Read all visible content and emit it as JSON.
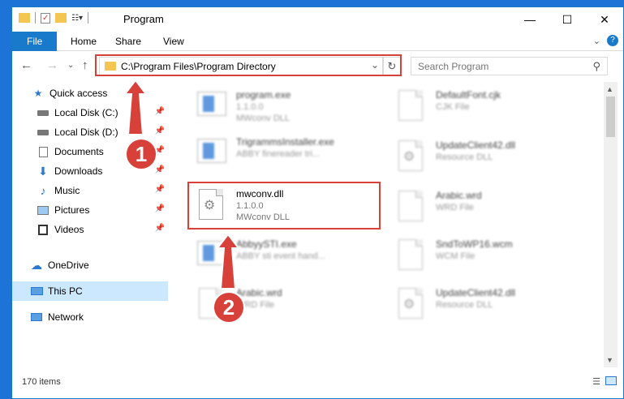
{
  "window": {
    "title": "Program",
    "controls": [
      "minimize",
      "maximize",
      "close"
    ]
  },
  "ribbon": {
    "tabs": [
      "File",
      "Home",
      "Share",
      "View"
    ]
  },
  "nav": {
    "address": "C:\\Program Files\\Program Directory",
    "search_placeholder": "Search Program"
  },
  "sidebar": {
    "items": [
      {
        "label": "Quick access",
        "icon": "star-icon"
      },
      {
        "label": "Local Disk (C:)",
        "icon": "drive-icon",
        "pinned": true
      },
      {
        "label": "Local Disk (D:)",
        "icon": "drive-icon",
        "pinned": true
      },
      {
        "label": "Documents",
        "icon": "documents-icon",
        "pinned": true
      },
      {
        "label": "Downloads",
        "icon": "download-icon",
        "pinned": true
      },
      {
        "label": "Music",
        "icon": "music-icon",
        "pinned": true
      },
      {
        "label": "Pictures",
        "icon": "pictures-icon",
        "pinned": true
      },
      {
        "label": "Videos",
        "icon": "videos-icon",
        "pinned": true
      },
      {
        "label": "OneDrive",
        "icon": "cloud-icon"
      },
      {
        "label": "This PC",
        "icon": "computer-icon",
        "selected": true
      },
      {
        "label": "Network",
        "icon": "network-icon"
      }
    ]
  },
  "files": {
    "left": [
      {
        "name": "program.exe",
        "line1": "1.1.0.0",
        "line2": "MWconv DLL",
        "type": "exe"
      },
      {
        "name": "TrigrammsInstaller.exe",
        "line1": "ABBY finereader tri...",
        "line2": "",
        "type": "exe"
      },
      {
        "name": "mwconv.dll",
        "line1": "1.1.0.0",
        "line2": "MWconv DLL",
        "type": "dll",
        "highlighted": true
      },
      {
        "name": "AbbyySTI.exe",
        "line1": "ABBY sti event hand...",
        "line2": "",
        "type": "exe"
      },
      {
        "name": "Arabic.wrd",
        "line1": "WRD File",
        "line2": "",
        "type": "doc"
      }
    ],
    "right": [
      {
        "name": "DefaultFont.cjk",
        "line1": "CJK File",
        "line2": "",
        "type": "doc"
      },
      {
        "name": "UpdateClient42.dll",
        "line1": "Resource DLL",
        "line2": "",
        "type": "dll"
      },
      {
        "name": "Arabic.wrd",
        "line1": "WRD File",
        "line2": "",
        "type": "doc"
      },
      {
        "name": "SndToWP16.wcm",
        "line1": "WCM File",
        "line2": "",
        "type": "doc"
      },
      {
        "name": "UpdateClient42.dll",
        "line1": "Resource DLL",
        "line2": "",
        "type": "dll"
      }
    ]
  },
  "status": {
    "count": "170 items"
  },
  "annotations": {
    "step1": "1",
    "step2": "2",
    "color": "#d8413a"
  }
}
